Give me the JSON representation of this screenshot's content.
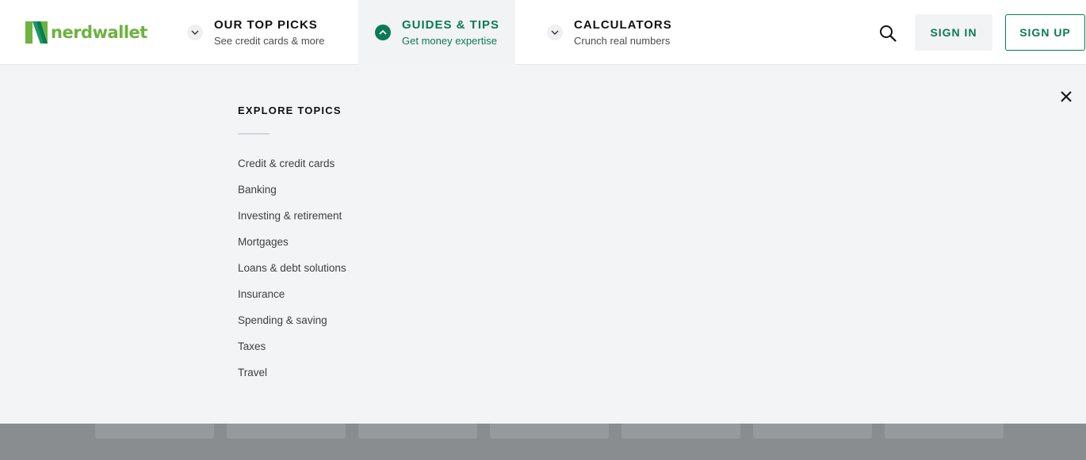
{
  "header": {
    "logo": {
      "text": "nerdwallet",
      "icon": "nerdwallet-n-logo",
      "brand_color": "#6cb33f"
    },
    "nav": {
      "picks": {
        "title": "OUR TOP PICKS",
        "subtitle": "See credit cards & more",
        "icon": "chevron-down-icon",
        "expanded": false
      },
      "guides": {
        "title": "GUIDES & TIPS",
        "subtitle": "Get money expertise",
        "icon": "chevron-up-icon",
        "expanded": true
      },
      "calculators": {
        "title": "CALCULATORS",
        "subtitle": "Crunch real numbers",
        "icon": "chevron-down-icon",
        "expanded": false
      }
    },
    "search_icon": "search-icon",
    "sign_in": "SIGN IN",
    "sign_up": "SIGN UP"
  },
  "dropdown": {
    "title": "EXPLORE TOPICS",
    "close_icon": "close-icon",
    "topics": [
      "Credit & credit cards",
      "Banking",
      "Investing & retirement",
      "Mortgages",
      "Loans & debt solutions",
      "Insurance",
      "Spending & saving",
      "Taxes",
      "Travel"
    ]
  },
  "colors": {
    "accent": "#0b7a55",
    "panel_bg": "#f3f4f5",
    "overlay": "#8a8d8f"
  }
}
